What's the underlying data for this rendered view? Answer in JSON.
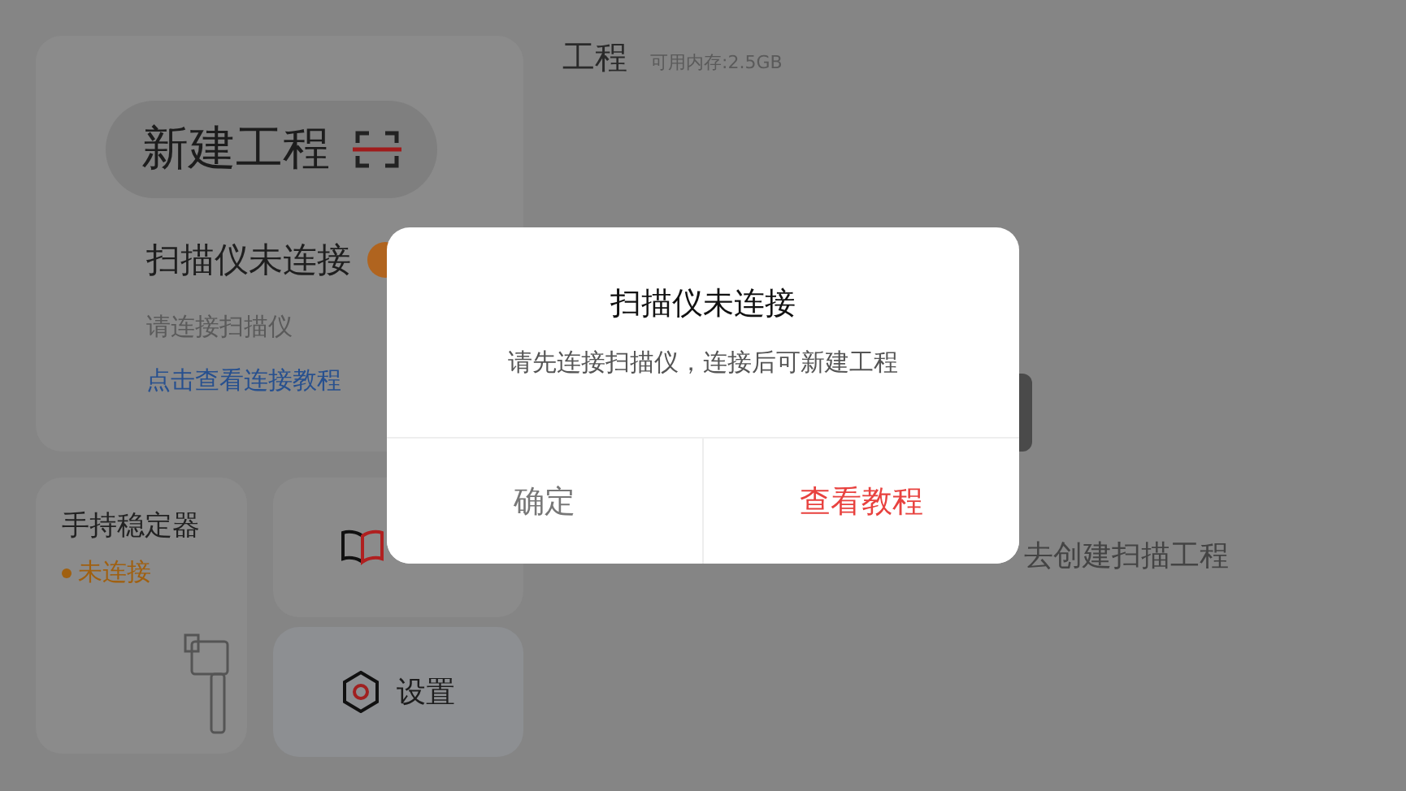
{
  "new_project": {
    "label": "新建工程"
  },
  "scanner": {
    "status": "扫描仪未连接",
    "hint": "请连接扫描仪",
    "link": "点击查看连接教程"
  },
  "stabilizer": {
    "title": "手持稳定器",
    "status": "未连接",
    "connected": false
  },
  "settings": {
    "label": "设置"
  },
  "header": {
    "title": "工程",
    "memory": "可用内存:2.5GB"
  },
  "empty_hint": "去创建扫描工程",
  "dialog": {
    "title": "扫描仪未连接",
    "message": "请先连接扫描仪，连接后可新建工程",
    "buttons": [
      {
        "label": "确定",
        "kind": "cancel"
      },
      {
        "label": "查看教程",
        "kind": "primary"
      }
    ]
  }
}
